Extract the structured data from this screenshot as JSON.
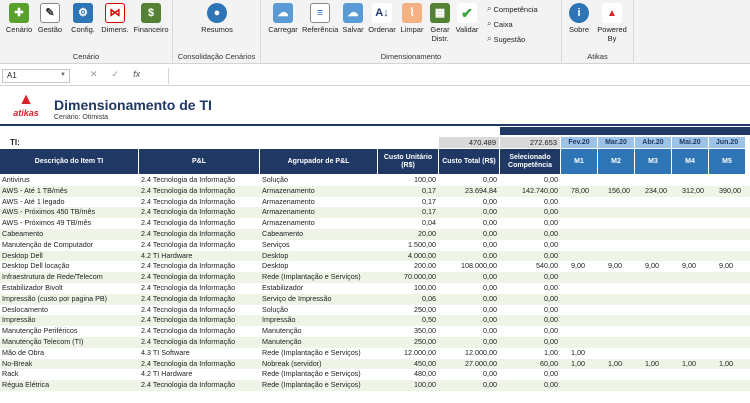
{
  "ribbon": {
    "groups": [
      {
        "label": "Cenário"
      },
      {
        "label": "Consolidação Cenários"
      },
      {
        "label": "Dimensionamento"
      },
      {
        "label": "Atikas"
      }
    ],
    "buttons": {
      "cenario": "Cenário",
      "gestao": "Gestão",
      "config": "Config.",
      "dimens": "Dimens.",
      "financeiro": "Financeiro",
      "resumos": "Resumos",
      "carregar": "Carregar",
      "referencia": "Referência",
      "salvar": "Salvar",
      "ordenar": "Ordenar",
      "limpar": "Limpar",
      "gerar": "Gerar Distr.",
      "validar": "Validar",
      "competencia": "Competência",
      "caixa": "Caixa",
      "sugestao": "Sugestão",
      "sobre": "Sobre",
      "powered": "Powered By",
      "atikas_logo": "atikas"
    }
  },
  "formula_bar": {
    "cell": "A1",
    "cancel": "✕",
    "confirm": "✓",
    "fx": "fx",
    "value": ""
  },
  "sheet": {
    "logo_word": "atikas",
    "title": "Dimensionamento de TI",
    "subtitle": "Cenário: Otimista",
    "ti_label": "TI:",
    "total_custo": "470.489",
    "total_selecionado": "272.653",
    "months": [
      "Fev.20",
      "Mar.20",
      "Abr.20",
      "Mai.20",
      "Jun.20"
    ],
    "headers": {
      "descricao": "Descrição do Item TI",
      "pl": "P&L",
      "agrupador": "Agrupador de P&L",
      "custo_unit": "Custo Unitário (R$)",
      "custo_total": "Custo Total (R$)",
      "selecionado": "Selecionado Competência",
      "m": [
        "M1",
        "M2",
        "M3",
        "M4",
        "M5"
      ]
    },
    "rows": [
      {
        "d": "Antivirus",
        "p": "2.4 Tecnologia da Informação",
        "a": "Solução",
        "cu": "100,00",
        "ct": "0,00",
        "s": "0,00",
        "m": [
          "",
          "",
          "",
          "",
          ""
        ]
      },
      {
        "d": "AWS - Até 1 TB/mês",
        "p": "2.4 Tecnologia da Informação",
        "a": "Armazenamento",
        "cu": "0,17",
        "ct": "23.694,84",
        "s": "142.740,00",
        "m": [
          "78,00",
          "156,00",
          "234,00",
          "312,00",
          "390,00"
        ]
      },
      {
        "d": "AWS - Até 1 legado",
        "p": "2.4 Tecnologia da Informação",
        "a": "Armazenamento",
        "cu": "0,17",
        "ct": "0,00",
        "s": "0,00",
        "m": [
          "",
          "",
          "",
          "",
          ""
        ]
      },
      {
        "d": "AWS - Próximos 450 TB/mês",
        "p": "2.4 Tecnologia da Informação",
        "a": "Armazenamento",
        "cu": "0,17",
        "ct": "0,00",
        "s": "0,00",
        "m": [
          "",
          "",
          "",
          "",
          ""
        ]
      },
      {
        "d": "AWS - Próximos 49 TB/mês",
        "p": "2.4 Tecnologia da Informação",
        "a": "Armazenamento",
        "cu": "0,04",
        "ct": "0,00",
        "s": "0,00",
        "m": [
          "",
          "",
          "",
          "",
          ""
        ]
      },
      {
        "d": "Cabeamento",
        "p": "2.4 Tecnologia da Informação",
        "a": "Cabeamento",
        "cu": "20,00",
        "ct": "0,00",
        "s": "0,00",
        "m": [
          "",
          "",
          "",
          "",
          ""
        ]
      },
      {
        "d": "Manutenção de Computador",
        "p": "2.4 Tecnologia da Informação",
        "a": "Serviços",
        "cu": "1.500,00",
        "ct": "0,00",
        "s": "0,00",
        "m": [
          "",
          "",
          "",
          "",
          ""
        ]
      },
      {
        "d": "Desktop Dell",
        "p": "4.2 TI Hardware",
        "a": "Desktop",
        "cu": "4.000,00",
        "ct": "0,00",
        "s": "0,00",
        "m": [
          "",
          "",
          "",
          "",
          ""
        ]
      },
      {
        "d": "Desktop Dell locação",
        "p": "2.4 Tecnologia da Informação",
        "a": "Desktop",
        "cu": "200,00",
        "ct": "108.000,00",
        "s": "540,00",
        "m": [
          "9,00",
          "9,00",
          "9,00",
          "9,00",
          "9,00"
        ]
      },
      {
        "d": "Infraestrutura de Rede/Telecom",
        "p": "2.4 Tecnologia da Informação",
        "a": "Rede (Implantação e Serviços)",
        "cu": "70.000,00",
        "ct": "0,00",
        "s": "0,00",
        "m": [
          "",
          "",
          "",
          "",
          ""
        ]
      },
      {
        "d": "Estabilizador Bivolt",
        "p": "2.4 Tecnologia da Informação",
        "a": "Estabilizador",
        "cu": "100,00",
        "ct": "0,00",
        "s": "0,00",
        "m": [
          "",
          "",
          "",
          "",
          ""
        ]
      },
      {
        "d": "Impressão (custo por pagina PB)",
        "p": "2.4 Tecnologia da Informação",
        "a": "Serviço de Impressão",
        "cu": "0,06",
        "ct": "0,00",
        "s": "0,00",
        "m": [
          "",
          "",
          "",
          "",
          ""
        ]
      },
      {
        "d": "Deslocamento",
        "p": "2.4 Tecnologia da Informação",
        "a": "Solução",
        "cu": "250,00",
        "ct": "0,00",
        "s": "0,00",
        "m": [
          "",
          "",
          "",
          "",
          ""
        ]
      },
      {
        "d": "Impressão",
        "p": "2.4 Tecnologia da Informação",
        "a": "Impressão",
        "cu": "0,50",
        "ct": "0,00",
        "s": "0,00",
        "m": [
          "",
          "",
          "",
          "",
          ""
        ]
      },
      {
        "d": "Manutenção Periféricos",
        "p": "2.4 Tecnologia da Informação",
        "a": "Manutenção",
        "cu": "350,00",
        "ct": "0,00",
        "s": "0,00",
        "m": [
          "",
          "",
          "",
          "",
          ""
        ]
      },
      {
        "d": "Manutenção Telecom (TI)",
        "p": "2.4 Tecnologia da Informação",
        "a": "Manutenção",
        "cu": "250,00",
        "ct": "0,00",
        "s": "0,00",
        "m": [
          "",
          "",
          "",
          "",
          ""
        ]
      },
      {
        "d": "Mão de Obra",
        "p": "4.3 TI Software",
        "a": "Rede (Implantação e Serviços)",
        "cu": "12.000,00",
        "ct": "12.000,00",
        "s": "1,00",
        "m": [
          "1,00",
          "",
          "",
          "",
          ""
        ]
      },
      {
        "d": "No-Break",
        "p": "2.4 Tecnologia da Informação",
        "a": "Nobreak (servidor)",
        "cu": "450,00",
        "ct": "27.000,00",
        "s": "60,00",
        "m": [
          "1,00",
          "1,00",
          "1,00",
          "1,00",
          "1,00"
        ]
      },
      {
        "d": "Rack",
        "p": "4.2 TI Hardware",
        "a": "Rede (Implantação e Serviços)",
        "cu": "480,00",
        "ct": "0,00",
        "s": "0,00",
        "m": [
          "",
          "",
          "",
          "",
          ""
        ]
      },
      {
        "d": "Régua Elétrica",
        "p": "2.4 Tecnologia da Informação",
        "a": "Rede (Implantação e Serviços)",
        "cu": "100,00",
        "ct": "0,00",
        "s": "0,00",
        "m": [
          "",
          "",
          "",
          "",
          ""
        ]
      }
    ]
  }
}
